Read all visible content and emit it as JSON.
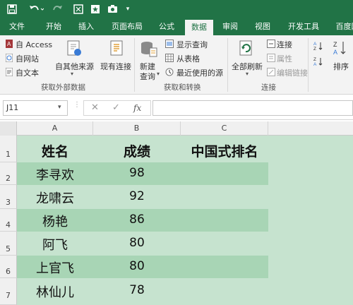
{
  "quick_access": {
    "save_icon": "save-icon",
    "undo_icon": "undo-icon",
    "redo_icon": "redo-icon"
  },
  "tabs": [
    {
      "label": "文件"
    },
    {
      "label": "开始"
    },
    {
      "label": "插入"
    },
    {
      "label": "页面布局"
    },
    {
      "label": "公式"
    },
    {
      "label": "数据"
    },
    {
      "label": "审阅"
    },
    {
      "label": "视图"
    },
    {
      "label": "开发工具"
    },
    {
      "label": "百度网"
    }
  ],
  "ribbon": {
    "get_external": {
      "access": "自 Access",
      "web": "自网站",
      "text": "自文本",
      "other": "自其他来源",
      "existing": "现有连接",
      "label": "获取外部数据"
    },
    "get_transform": {
      "new_query_1": "新建",
      "new_query_2": "查询",
      "show_queries": "显示查询",
      "from_table": "从表格",
      "recent_sources": "最近使用的源",
      "label": "获取和转换"
    },
    "connections": {
      "refresh_all": "全部刷新",
      "connections": "连接",
      "properties": "属性",
      "edit_links": "编辑链接",
      "label": "连接"
    },
    "sort": {
      "sort": "排序"
    }
  },
  "formula_bar": {
    "name_box": "J11",
    "fx": "fx",
    "formula": ""
  },
  "sheet": {
    "columns": [
      "A",
      "B",
      "C"
    ],
    "rows": [
      "1",
      "2",
      "3",
      "4",
      "5",
      "6",
      "7"
    ],
    "header": {
      "name": "姓名",
      "score": "成绩",
      "rank": "中国式排名"
    },
    "data": [
      {
        "name": "李寻欢",
        "score": "98"
      },
      {
        "name": "龙啸云",
        "score": "92"
      },
      {
        "name": "杨艳",
        "score": "86"
      },
      {
        "name": "阿飞",
        "score": "80"
      },
      {
        "name": "上官飞",
        "score": "80"
      },
      {
        "name": "林仙儿",
        "score": "78"
      }
    ]
  },
  "colors": {
    "excel_green": "#217346",
    "sheet_bg": "#c6e3cf",
    "band": "#a8d5b5"
  }
}
